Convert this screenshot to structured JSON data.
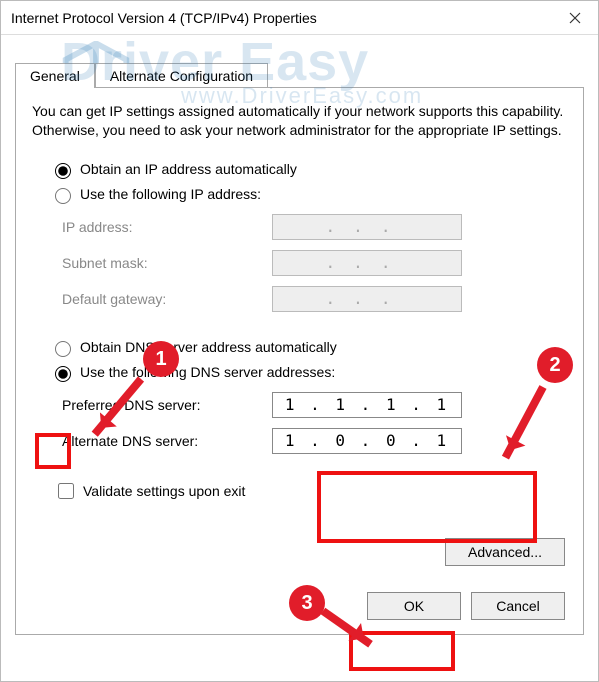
{
  "title": "Internet Protocol Version 4 (TCP/IPv4) Properties",
  "tabs": {
    "general": "General",
    "alt": "Alternate Configuration"
  },
  "desc": "You can get IP settings assigned automatically if your network supports this capability. Otherwise, you need to ask your network administrator for the appropriate IP settings.",
  "ip_group": {
    "auto": "Obtain an IP address automatically",
    "manual": "Use the following IP address:",
    "fields": {
      "ip": "IP address:",
      "mask": "Subnet mask:",
      "gw": "Default gateway:"
    }
  },
  "dns_group": {
    "auto": "Obtain DNS server address automatically",
    "manual": "Use the following DNS server addresses:",
    "fields": {
      "pref": "Preferred DNS server:",
      "alt": "Alternate DNS server:"
    },
    "values": {
      "pref": "1 . 1 . 1 . 1",
      "alt": "1 . 0 . 0 . 1"
    }
  },
  "validate": "Validate settings upon exit",
  "buttons": {
    "advanced": "Advanced...",
    "ok": "OK",
    "cancel": "Cancel"
  },
  "watermark": {
    "big": "Driver Easy",
    "small": "www.DriverEasy.com"
  },
  "annotations": {
    "b1": "1",
    "b2": "2",
    "b3": "3"
  },
  "dot_placeholder": "..."
}
